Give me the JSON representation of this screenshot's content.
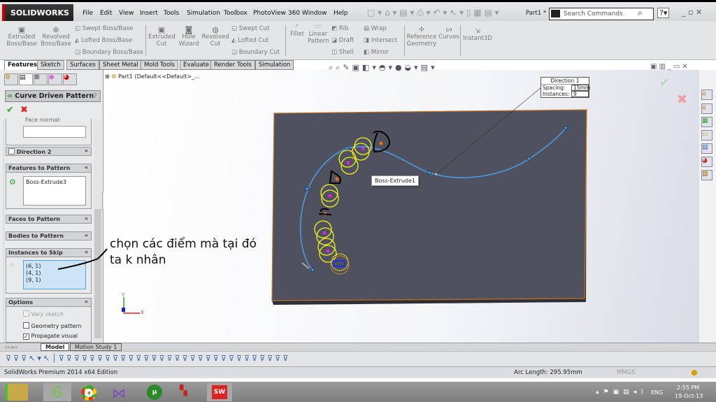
{
  "app": {
    "logo": "SOLIDWORKS",
    "document": "Part1 *",
    "search_placeholder": "Search Commands"
  },
  "menu": [
    "File",
    "Edit",
    "View",
    "Insert",
    "Tools",
    "Simulation",
    "Toolbox",
    "PhotoView 360",
    "Window",
    "Help"
  ],
  "ribbon": {
    "extruded_boss": "Extruded Boss/Base",
    "revolved_boss": "Revolved Boss/Base",
    "swept_boss": "Swept Boss/Base",
    "lofted_boss": "Lofted Boss/Base",
    "boundary_boss": "Boundary Boss/Base",
    "extruded_cut": "Extruded Cut",
    "hole_wizard": "Hole Wizard",
    "revolved_cut": "Revolved Cut",
    "swept_cut": "Swept Cut",
    "lofted_cut": "Lofted Cut",
    "boundary_cut": "Boundary Cut",
    "fillet": "Fillet",
    "linear_pattern": "Linear Pattern",
    "rib": "Rib",
    "draft": "Draft",
    "shell": "Shell",
    "wrap": "Wrap",
    "intersect": "Intersect",
    "mirror": "Mirror",
    "reference_geometry": "Reference Geometry",
    "curves": "Curves",
    "instant3d": "Instant3D"
  },
  "tabs": [
    "Features",
    "Sketch",
    "Surfaces",
    "Sheet Metal",
    "Mold Tools",
    "Evaluate",
    "Render Tools",
    "Simulation"
  ],
  "property_manager": {
    "title": "Curve Driven Pattern",
    "face_normal_label": "Face normal:",
    "direction2": "Direction 2",
    "features_to_pattern": "Features to Pattern",
    "features_list": [
      "Boss-Extrude3"
    ],
    "faces_to_pattern": "Faces to Pattern",
    "bodies_to_pattern": "Bodies to Pattern",
    "instances_to_skip": "Instances to Skip",
    "skip_list": [
      "(6, 1)",
      "(4, 1)",
      "(9, 1)"
    ],
    "options": "Options",
    "vary_sketch": "Vary sketch",
    "geometry_pattern": "Geometry pattern",
    "propagate_visual": "Propagate visual"
  },
  "tree": {
    "root": "Part1  (Default<<Default>_..."
  },
  "callout": {
    "title": "Direction 1",
    "spacing_label": "Spacing:",
    "spacing_value": "15mm",
    "instances_label": "Instances:",
    "instances_value": "9"
  },
  "tooltip": "Boss-Extrude1",
  "annotation": {
    "line1": "chọn các điểm mà tại đó",
    "line2": "ta k nhân"
  },
  "axes": {
    "x": "X",
    "y": "Y"
  },
  "bottom_tabs": [
    "Model",
    "Motion Study 1"
  ],
  "status": {
    "edition": "SolidWorks Premium 2014 x64 Edition",
    "arc_length": "Arc Length: 295.95mm",
    "units": "MMGS"
  },
  "taskbar": {
    "lang": "ENG",
    "time": "2:55 PM",
    "date": "19-Oct-13"
  },
  "colors": {
    "curve": "#4a9be0",
    "plate": "#4f525e",
    "edge": "#c87020",
    "instance": "#f0f020",
    "point": "#e020e0"
  }
}
